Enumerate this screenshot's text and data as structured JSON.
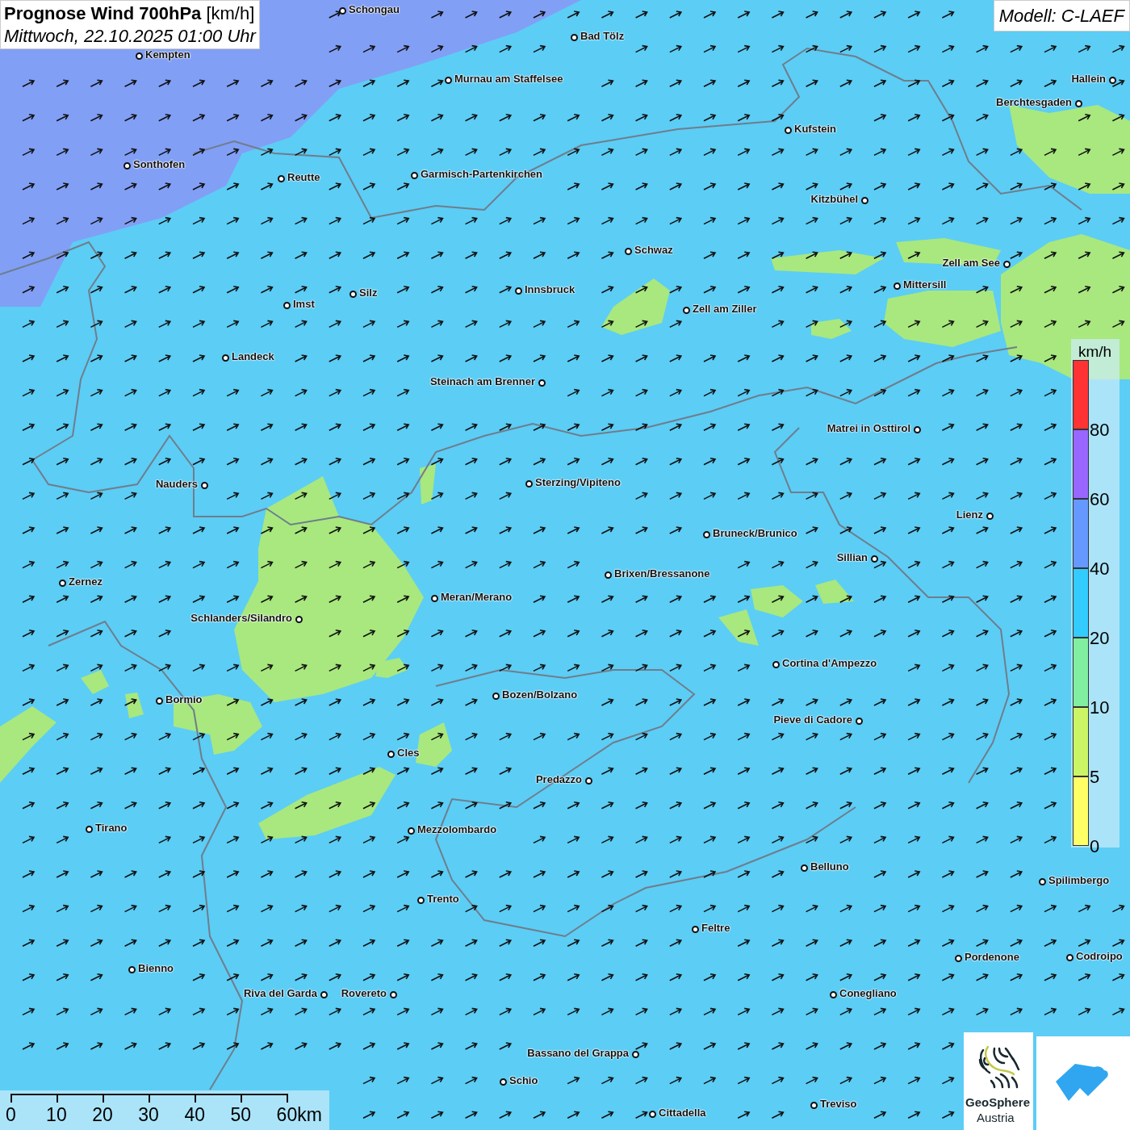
{
  "title": "**Prognose Wind 700hPa** [km/h]",
  "subtitle": "Mittwoch, 22.10.2025 01:00 Uhr",
  "model": "Modell: C-LAEF",
  "cities": [
    "Schongau",
    "Bad Tölz",
    "Kempten",
    "Murnau am Staffelsee",
    "Hallein",
    "Berchtesgaden",
    "Kufstein",
    "Sonthofen",
    "Reutte",
    "Garmisch-Partenkirchen",
    "Kitzbühel",
    "Schwaz",
    "Zell am See",
    "Mittersill",
    "Innsbruck",
    "Silz",
    "Zell am Ziller",
    "Imst",
    "Landeck",
    "Steinach am Brenner",
    "Matrei in Osttirol",
    "Nauders",
    "Sterzing/Vipiteno",
    "Lienz",
    "Bruneck/Brunico",
    "Sillian",
    "Brixen/Bressanone",
    "Zernez",
    "Meran/Merano",
    "Schlanders/Silandro",
    "Cortina d'Ampezzo",
    "Bozen/Bolzano",
    "Bormio",
    "Pieve di Cadore",
    "Cles",
    "Predazzo",
    "Tirano",
    "Mezzolombardo",
    "Belluno",
    "Spilimbergo",
    "Trento",
    "Feltre",
    "Pordenone",
    "Codroipo",
    "Bienno",
    "Riva del Garda",
    "Rovereto",
    "Conegliano",
    "Bassano del Grappa",
    "Schio",
    "Treviso",
    "Cittadella"
  ],
  "legend": {
    "unit": "km/h",
    "steps": [
      {
        "color": "#ff3333",
        "label": "80"
      },
      {
        "color": "#9966ff",
        "label": "60"
      },
      {
        "color": "#6699ff",
        "label": "40"
      },
      {
        "color": "#33ccff",
        "label": "20"
      },
      {
        "color": "#80f0a0",
        "label": "10"
      },
      {
        "color": "#ccf566",
        "label": "5"
      },
      {
        "color": "#ffff66",
        "label": "0"
      }
    ]
  },
  "scale_bar": {
    "labels": [
      "0",
      "10",
      "20",
      "30",
      "40",
      "50",
      "60km"
    ]
  },
  "logo": {
    "name": "GeoSphere",
    "subname": "Austria"
  }
}
